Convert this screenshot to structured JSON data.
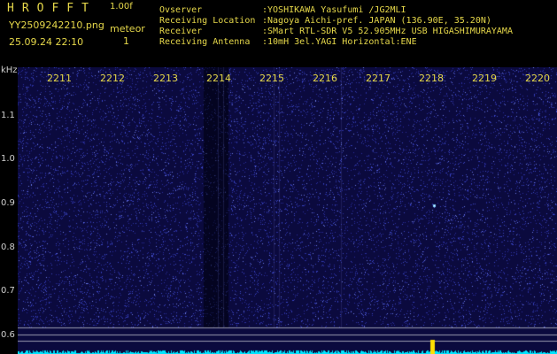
{
  "header": {
    "app_title": "HROFFT",
    "version": "1.00f",
    "filename": "YY2509242210.png",
    "datetime": "25.09.24 22:10",
    "meteor_label": "meteor",
    "meteor_count": "1"
  },
  "info": [
    {
      "key": "Ovserver",
      "value": ":YOSHIKAWA Yasufumi /JG2MLI"
    },
    {
      "key": "Receiving Location",
      "value": ":Nagoya Aichi-pref. JAPAN (136.90E, 35.20N)"
    },
    {
      "key": "Receiver",
      "value": ":SMart RTL-SDR V5 52.905MHz USB HIGASHIMURAYAMA"
    },
    {
      "key": "Receiving Antenna",
      "value": ":10mH 3el.YAGI Horizontal:ENE"
    }
  ],
  "axes": {
    "y_unit": "kHz",
    "y_ticks": [
      "1.1",
      "1.0",
      "0.9",
      "0.8",
      "0.7",
      "0.6"
    ],
    "x_ticks": [
      "2211",
      "2212",
      "2213",
      "2214",
      "2215",
      "2216",
      "2217",
      "2218",
      "2219",
      "2220"
    ]
  },
  "colors": {
    "background": "#0b0a3e",
    "tick_text": "#e6d84a",
    "detection": "#ffe000",
    "spectrum": "#00e5ff"
  }
}
